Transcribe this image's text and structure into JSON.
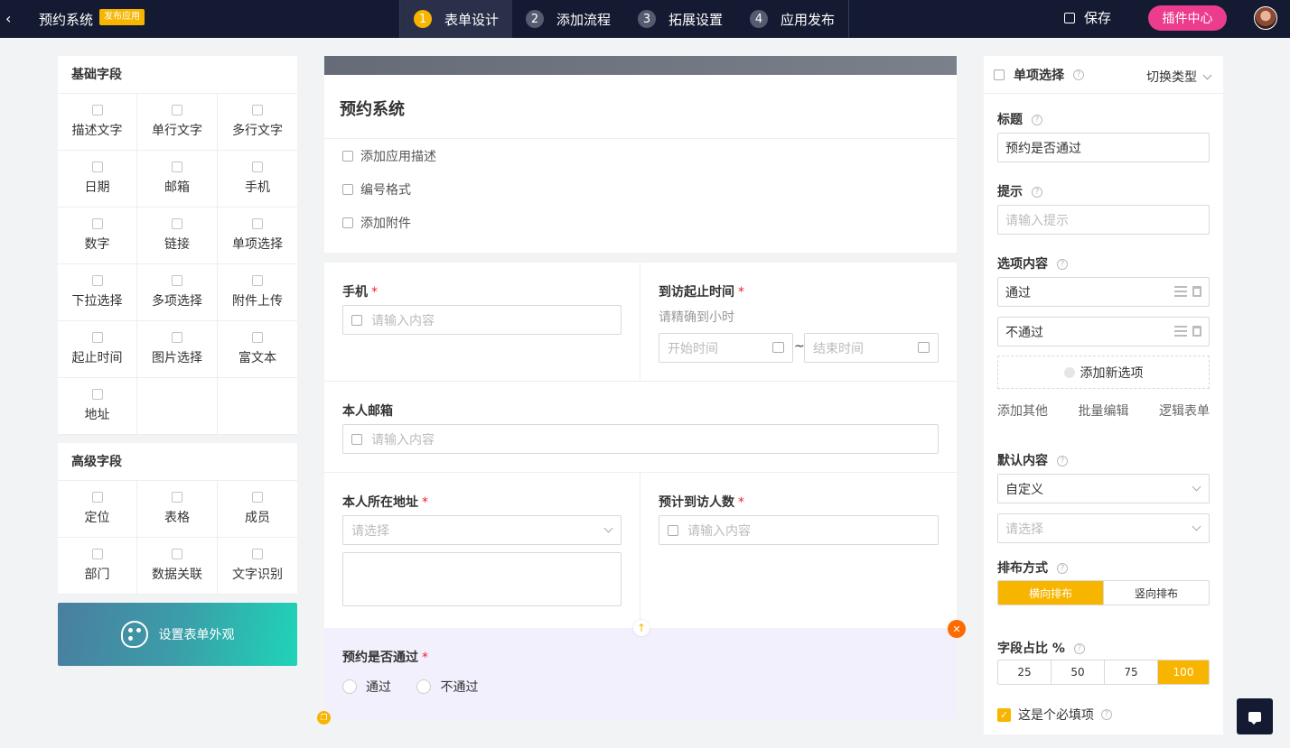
{
  "topbar": {
    "app_title": "预约系统",
    "publish_badge": "发布应用",
    "steps": [
      {
        "num": "1",
        "label": "表单设计"
      },
      {
        "num": "2",
        "label": "添加流程"
      },
      {
        "num": "3",
        "label": "拓展设置"
      },
      {
        "num": "4",
        "label": "应用发布"
      }
    ],
    "save_label": "保存",
    "plugin_label": "插件中心"
  },
  "left": {
    "basic_title": "基础字段",
    "basic_fields": [
      "描述文字",
      "单行文字",
      "多行文字",
      "日期",
      "邮箱",
      "手机",
      "数字",
      "链接",
      "单项选择",
      "下拉选择",
      "多项选择",
      "附件上传",
      "起止时间",
      "图片选择",
      "富文本",
      "地址"
    ],
    "advanced_title": "高级字段",
    "advanced_fields": [
      "定位",
      "表格",
      "成员",
      "部门",
      "数据关联",
      "文字识别"
    ],
    "appearance_label": "设置表单外观"
  },
  "form": {
    "title": "预约系统",
    "actions": [
      "添加应用描述",
      "编号格式",
      "添加附件"
    ],
    "phone": {
      "label": "手机",
      "placeholder": "请输入内容"
    },
    "visit_time": {
      "label": "到访起止时间",
      "hint": "请精确到小时",
      "start": "开始时间",
      "end": "结束时间",
      "sep": "~"
    },
    "email": {
      "label": "本人邮箱",
      "placeholder": "请输入内容"
    },
    "address": {
      "label": "本人所在地址",
      "placeholder": "请选择"
    },
    "visitors": {
      "label": "预计到访人数",
      "placeholder": "请输入内容"
    },
    "approval": {
      "label": "预约是否通过",
      "options": [
        "通过",
        "不通过"
      ]
    },
    "required_mark": "*"
  },
  "right": {
    "header": "单项选择",
    "switch_type": "切换类型",
    "title_label": "标题",
    "title_value": "预约是否通过",
    "hint_label": "提示",
    "hint_placeholder": "请输入提示",
    "options_label": "选项内容",
    "options": [
      "通过",
      "不通过"
    ],
    "add_option": "添加新选项",
    "links": [
      "添加其他",
      "批量编辑",
      "逻辑表单"
    ],
    "default_label": "默认内容",
    "default_value": "自定义",
    "default_placeholder": "请选择",
    "layout_label": "排布方式",
    "layout_options": [
      "横向排布",
      "竖向排布"
    ],
    "ratio_label": "字段占比 %",
    "ratio_options": [
      "25",
      "50",
      "75",
      "100"
    ],
    "required_label": "这是个必填项"
  }
}
